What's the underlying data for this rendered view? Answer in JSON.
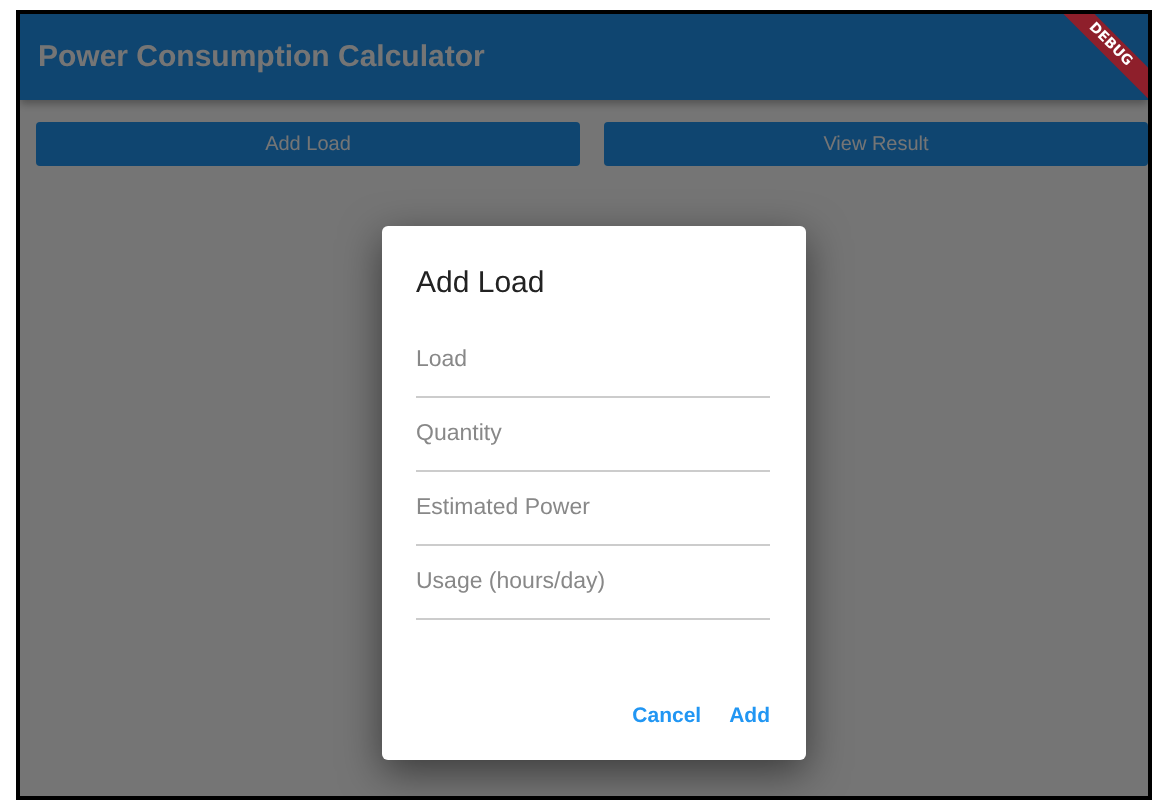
{
  "app_bar": {
    "title": "Power Consumption Calculator",
    "banner": "DEBUG"
  },
  "buttons": [
    "Add Load",
    "View Result"
  ],
  "dialog": {
    "title": "Add Load",
    "fields": [
      {
        "placeholder": "Load"
      },
      {
        "placeholder": "Quantity"
      },
      {
        "placeholder": "Estimated Power"
      },
      {
        "placeholder": "Usage (hours/day)"
      }
    ],
    "actions": [
      "Cancel",
      "Add"
    ]
  }
}
